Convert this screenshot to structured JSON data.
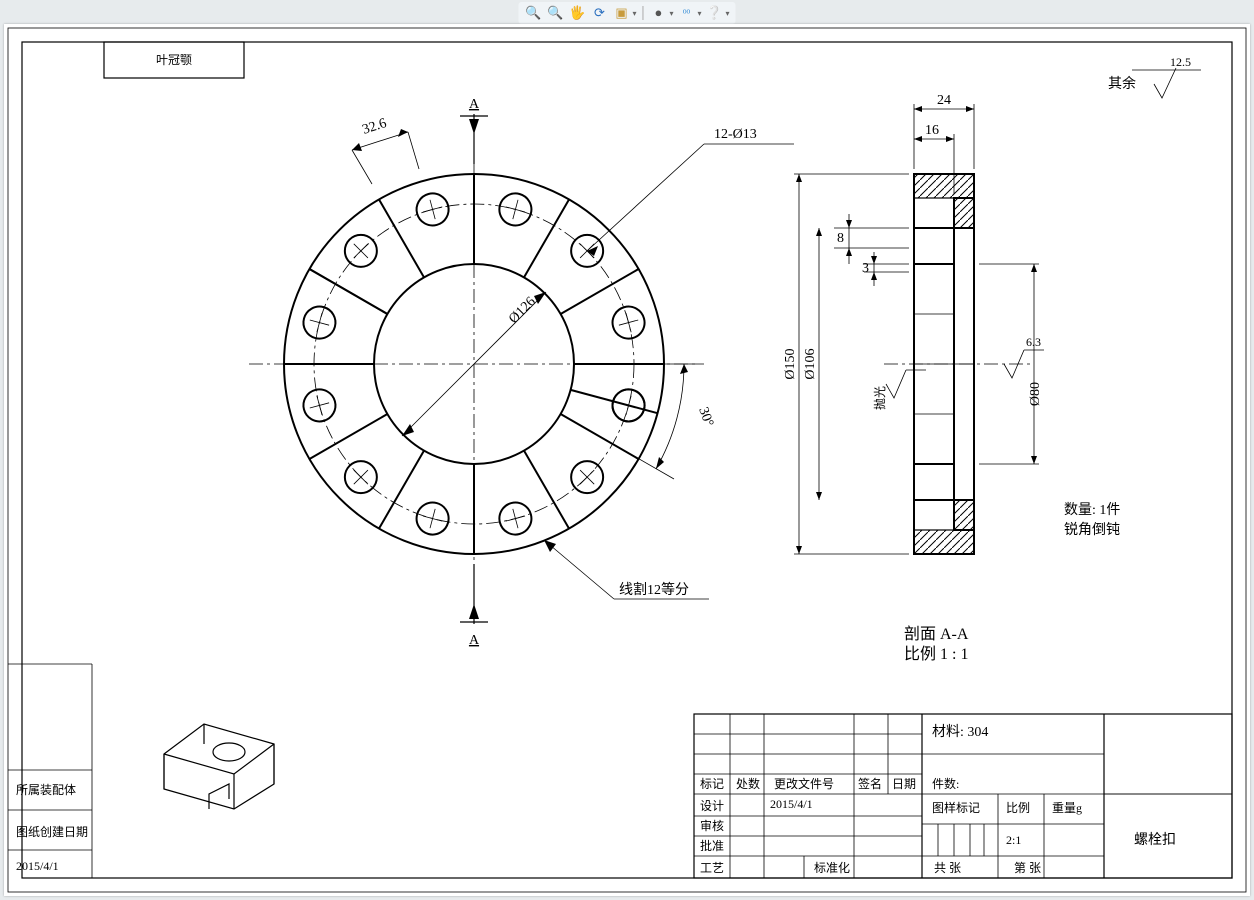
{
  "toolbar": {
    "zoom_in": "🔍",
    "zoom_out": "🔍",
    "pan": "🤚",
    "refresh": "🔄",
    "view": "📦",
    "dot": "•",
    "options": "⚙",
    "help": "❔"
  },
  "frame": {
    "top_left_label": "叶冠颚",
    "side_tags": {
      "assembly": "所属装配体",
      "date_label": "图纸创建日期",
      "date_value": "2015/4/1"
    }
  },
  "front_view": {
    "section_letter": "A",
    "dim_bcd": "Ø126",
    "dim_hole": "12-Ø13",
    "angle": "30°",
    "spacing": "32.6",
    "note_wirecut": "线割12等分"
  },
  "section_aa": {
    "title_line1": "剖面 A-A",
    "title_line2": "比例 1 : 1",
    "dim_24": "24",
    "dim_16": "16",
    "dim_8": "8",
    "dim_3": "3",
    "dim_150": "Ø150",
    "dim_106": "Ø106",
    "dim_80": "Ø80",
    "surf_a": "抛光",
    "surf_b": "6.3"
  },
  "notes": {
    "surface_rest": "其余",
    "surface_rest_val": "12.5",
    "qty": "数量: 1件",
    "edges": "锐角倒钝"
  },
  "title_block": {
    "material": "材料: 304",
    "pieces": "件数:",
    "mark": "标记",
    "place": "处数",
    "change_doc": "更改文件号",
    "sign": "签名",
    "date": "日期",
    "design": "设计",
    "design_date": "2015/4/1",
    "check": "审核",
    "approve": "批准",
    "process": "工艺",
    "standardize": "标准化",
    "fig_mark": "图样标记",
    "ratio": "比例",
    "weight": "重量g",
    "scale_val": "2:1",
    "sheets_total": "共 张",
    "sheet_no": "第 张",
    "part_name": "螺栓扣"
  }
}
